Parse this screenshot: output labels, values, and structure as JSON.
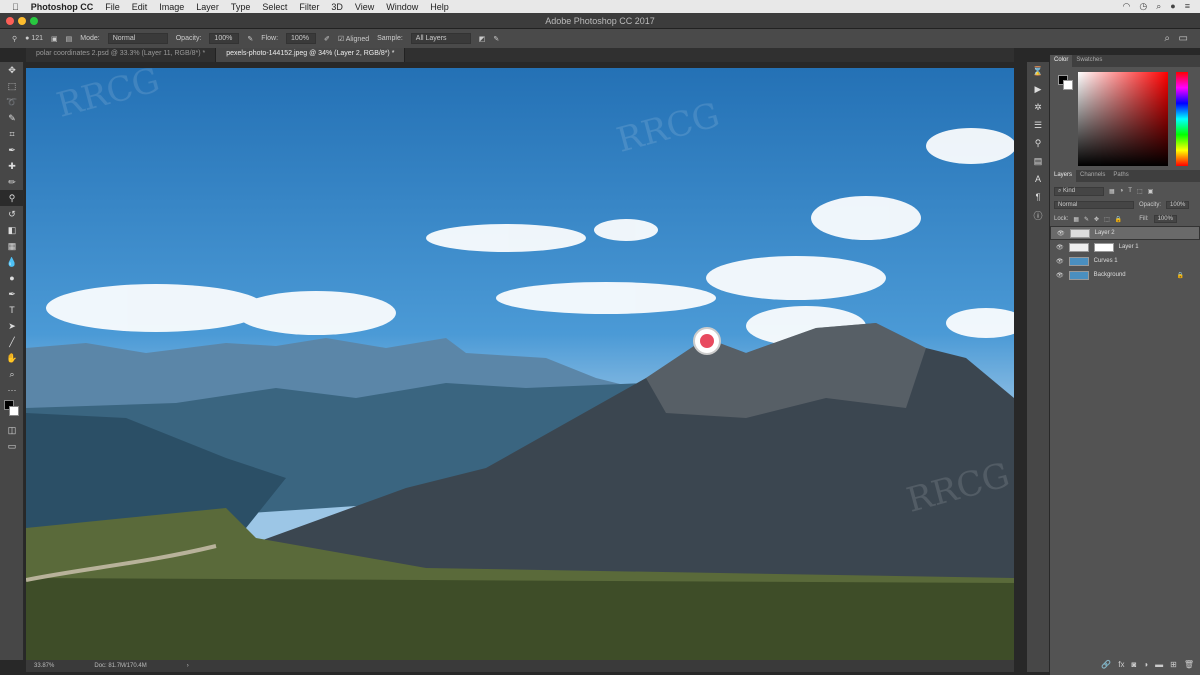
{
  "menubar": {
    "app": "Photoshop CC",
    "items": [
      "File",
      "Edit",
      "Image",
      "Layer",
      "Type",
      "Select",
      "Filter",
      "3D",
      "View",
      "Window",
      "Help"
    ]
  },
  "window": {
    "title": "Adobe Photoshop CC 2017"
  },
  "options": {
    "brush_size": "121",
    "mode_label": "Mode:",
    "mode": "Normal",
    "opacity_label": "Opacity:",
    "opacity": "100%",
    "flow_label": "Flow:",
    "flow": "100%",
    "aligned": "Aligned",
    "sample_label": "Sample:",
    "sample": "All Layers"
  },
  "tabs": [
    {
      "label": "polar coordinates 2.psd @ 33.3% (Layer 11, RGB/8*) *"
    },
    {
      "label": "pexels-photo-144152.jpeg @ 34% (Layer 2, RGB/8*) *"
    }
  ],
  "status": {
    "zoom": "33.87%",
    "doc": "Doc: 81.7M/170.4M"
  },
  "color_panel": {
    "tabs": [
      "Color",
      "Swatches"
    ]
  },
  "layers_panel": {
    "tabs": [
      "Layers",
      "Channels",
      "Paths"
    ],
    "filter": "Kind",
    "blend": "Normal",
    "opacity_label": "Opacity:",
    "opacity": "100%",
    "lock_label": "Lock:",
    "fill_label": "Fill:",
    "fill": "100%",
    "layers": [
      {
        "name": "Layer 2"
      },
      {
        "name": "Layer 1"
      },
      {
        "name": "Curves 1"
      },
      {
        "name": "Background"
      }
    ]
  },
  "watermark": "RRCG",
  "colors": {
    "accent": "#e84a5f"
  }
}
